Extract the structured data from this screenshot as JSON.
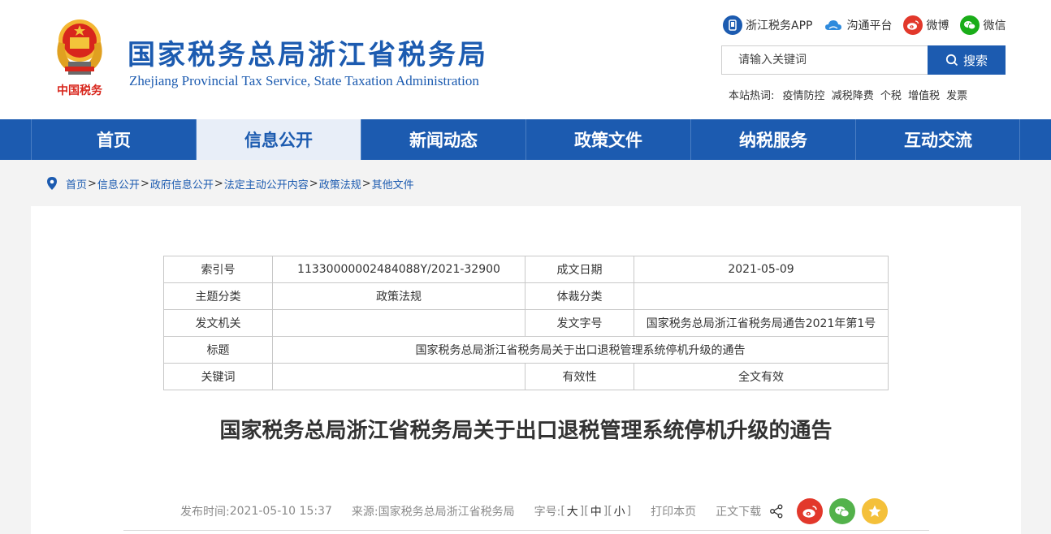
{
  "header": {
    "title": "国家税务总局浙江省税务局",
    "subtitle": "Zhejiang Provincial Tax Service, State Taxation Administration",
    "emblem_caption": "中国税务",
    "top_links": [
      {
        "label": "浙江税务APP",
        "icon": "app-phone-icon",
        "color": "#1c5bb0"
      },
      {
        "label": "沟通平台",
        "icon": "cloud-icon",
        "color": "#2f8bdd"
      },
      {
        "label": "微博",
        "icon": "weibo-icon",
        "color": "#e2382b"
      },
      {
        "label": "微信",
        "icon": "wechat-icon",
        "color": "#1aad19"
      }
    ],
    "search": {
      "placeholder": "请输入关键词",
      "button_label": "搜索"
    },
    "hotwords": {
      "label": "本站热词:",
      "items": [
        "疫情防控",
        "减税降费",
        "个税",
        "增值税",
        "发票"
      ]
    }
  },
  "nav": {
    "items": [
      "首页",
      "信息公开",
      "新闻动态",
      "政策文件",
      "纳税服务",
      "互动交流"
    ],
    "active_index": 1
  },
  "breadcrumb": {
    "items": [
      "首页",
      "信息公开",
      "政府信息公开",
      "法定主动公开内容",
      "政策法规",
      "其他文件"
    ],
    "separator": ">"
  },
  "meta_table": {
    "index_label": "索引号",
    "index_value": "11330000002484088Y/2021-32900",
    "date_label": "成文日期",
    "date_value": "2021-05-09",
    "topic_label": "主题分类",
    "topic_value": "政策法规",
    "genre_label": "体裁分类",
    "genre_value": "",
    "issuer_label": "发文机关",
    "issuer_value": "",
    "docno_label": "发文字号",
    "docno_value": "国家税务总局浙江省税务局通告2021年第1号",
    "title_label": "标题",
    "title_value": "国家税务总局浙江省税务局关于出口退税管理系统停机升级的通告",
    "keyword_label": "关键词",
    "keyword_value": "",
    "validity_label": "有效性",
    "validity_value": "全文有效"
  },
  "document": {
    "title": "国家税务总局浙江省税务局关于出口退税管理系统停机升级的通告"
  },
  "info_bar": {
    "publish_label": "发布时间:",
    "publish_value": "2021-05-10  15:37",
    "source_label": "来源:",
    "source_value": "国家税务总局浙江省税务局",
    "font_size_label": "字号:",
    "font_large": "大",
    "font_medium": "中",
    "font_small": "小",
    "print_label": "打印本页",
    "download_label": "正文下载",
    "share_buttons": [
      {
        "icon": "weibo-share-icon",
        "color": "#e2382b"
      },
      {
        "icon": "wechat-share-icon",
        "color": "#53b24b"
      },
      {
        "icon": "qzone-share-icon",
        "color": "#f4c03a"
      }
    ]
  },
  "colors": {
    "primary": "#1c5bb0",
    "nav_active_bg": "#e8eef8",
    "page_bg": "#f3f3f3"
  }
}
